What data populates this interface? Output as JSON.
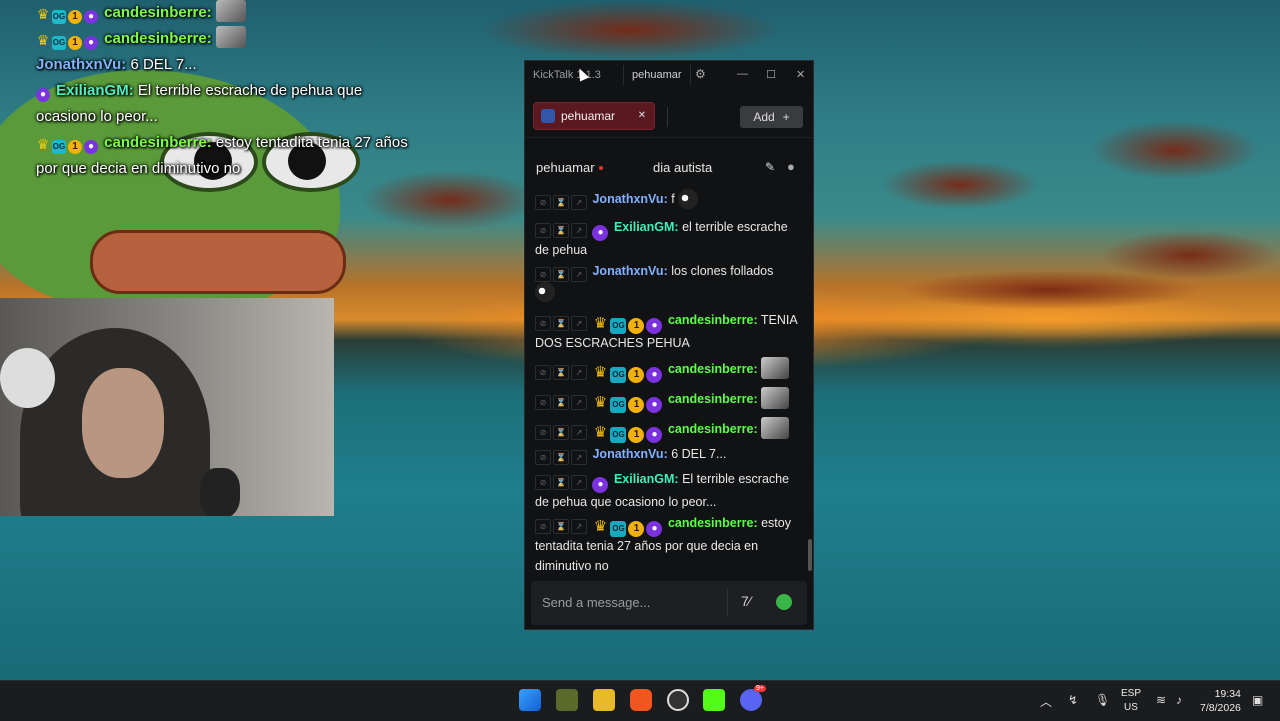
{
  "overlay_chat": [
    {
      "user": "candesinberre",
      "text": ""
    },
    {
      "user": "candesinberre",
      "text": ""
    },
    {
      "user": "JonathxnVu",
      "text": "6 DEL 7..."
    },
    {
      "user": "ExilianGM",
      "text": "El terrible escrache de pehua que ocasiono lo peor..."
    },
    {
      "user": "candesinberre",
      "text": "estoy tentadita tenia 27 años por que decia en diminutivo no"
    }
  ],
  "kicktalk": {
    "title": "KickTalk 1.1.3",
    "account": "pehuamar",
    "channel_tab": "pehuamar",
    "add_label": "Add",
    "channel_name": "pehuamar",
    "stream_title": "dia autista",
    "input_placeholder": "Send a message...",
    "messages": [
      {
        "user": "JonathxnVu",
        "text": "f"
      },
      {
        "user": "ExilianGM",
        "text": "el terrible escrache de pehua"
      },
      {
        "user": "JonathxnVu",
        "text": "los clones follados"
      },
      {
        "user": "candesinberre",
        "text": "TENIA DOS ESCRACHES PEHUA"
      },
      {
        "user": "candesinberre",
        "text": ""
      },
      {
        "user": "candesinberre",
        "text": ""
      },
      {
        "user": "candesinberre",
        "text": ""
      },
      {
        "user": "JonathxnVu",
        "text": "6 DEL 7..."
      },
      {
        "user": "ExilianGM",
        "text": "El terrible escrache de pehua que ocasiono lo peor..."
      },
      {
        "user": "candesinberre",
        "text": "estoy tentadita tenia 27 años por que decia en diminutivo no"
      }
    ],
    "colors": {
      "accent_tab": "#5a1820",
      "user_blue": "#82b1ff",
      "user_green": "#5aff46",
      "user_teal": "#3ef0b8"
    }
  },
  "taskbar": {
    "lang_top": "ESP",
    "lang_bottom": "US",
    "time": "19:34",
    "date": "7/8/2026",
    "discord_badge": "9+"
  }
}
